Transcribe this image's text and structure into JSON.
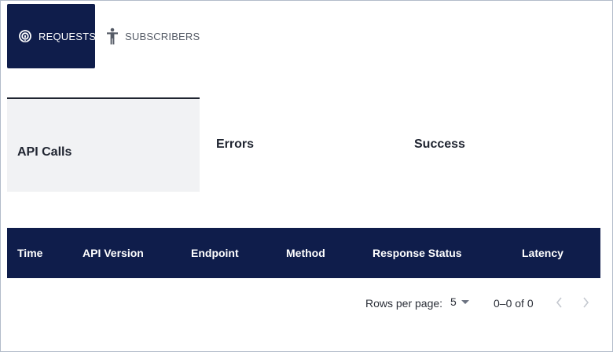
{
  "nav": {
    "requests": {
      "label": "REQUESTS",
      "icon": "radar-icon"
    },
    "subscribers": {
      "label": "SUBSCRIBERS",
      "icon": "person-icon"
    }
  },
  "tabs": [
    {
      "label": "API Calls",
      "active": true
    },
    {
      "label": "Errors",
      "active": false
    },
    {
      "label": "Success",
      "active": false
    }
  ],
  "table": {
    "columns": [
      "Time",
      "API Version",
      "Endpoint",
      "Method",
      "Response Status",
      "Latency"
    ],
    "rows": []
  },
  "pagination": {
    "rows_per_page_label": "Rows per page:",
    "rows_per_page_value": "5",
    "range_text": "0–0 of 0"
  },
  "colors": {
    "primary_navy": "#0f1d4b",
    "active_tab_bg": "#f1f2f4",
    "border": "#b3bcca"
  }
}
